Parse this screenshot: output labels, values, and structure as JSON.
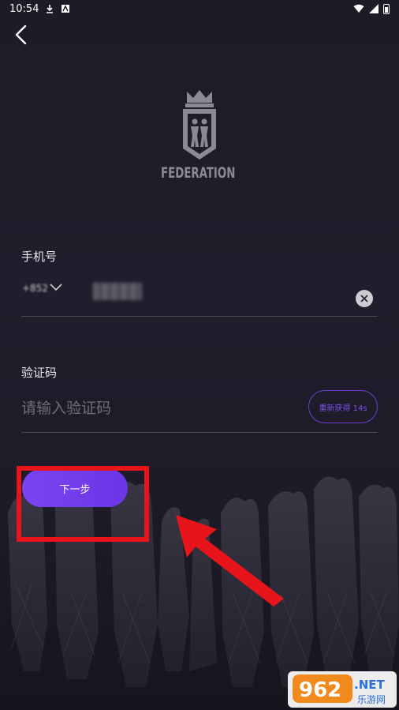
{
  "status_bar": {
    "time": "10:54",
    "icons": [
      "download-icon",
      "app-notification-icon",
      "wifi-icon",
      "signal-icon",
      "battery-icon"
    ]
  },
  "header": {
    "back_icon": "back-chevron-icon"
  },
  "logo": {
    "text": "FEDERATION",
    "icon": "crown-shield-logo"
  },
  "phone": {
    "label": "手机号",
    "country_code": "+852",
    "value": "",
    "clear_icon": "clear-icon"
  },
  "code": {
    "label": "验证码",
    "placeholder": "请输入验证码",
    "resend_label": "重新获得 14s"
  },
  "next_button": {
    "label": "下一步"
  },
  "annotation": {
    "highlight_color": "#e8141c"
  },
  "watermark": {
    "brand": "962.NET",
    "subtitle": "乐游网"
  },
  "colors": {
    "accent": "#7a44f0",
    "background": "#1f1d2a"
  }
}
